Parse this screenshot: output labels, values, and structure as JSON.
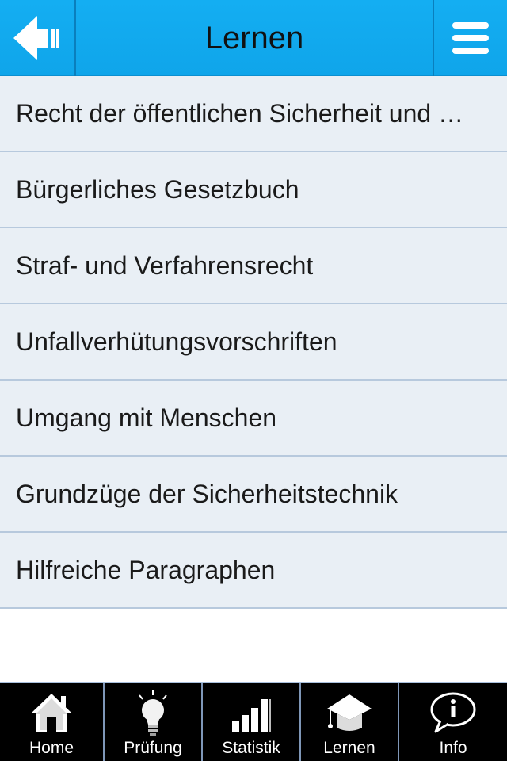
{
  "header": {
    "title": "Lernen",
    "back_icon": "back-arrow-icon",
    "menu_icon": "hamburger-menu-icon",
    "color": "#12abf0"
  },
  "list": {
    "items": [
      {
        "label": "Recht der öffentlichen Sicherheit und …"
      },
      {
        "label": "Bürgerliches Gesetzbuch"
      },
      {
        "label": "Straf- und Verfahrensrecht"
      },
      {
        "label": "Unfallverhütungsvorschriften"
      },
      {
        "label": "Umgang mit Menschen"
      },
      {
        "label": "Grundzüge der Sicherheitstechnik"
      },
      {
        "label": "Hilfreiche Paragraphen"
      }
    ]
  },
  "tabbar": {
    "tabs": [
      {
        "label": "Home",
        "icon": "house-icon"
      },
      {
        "label": "Prüfung",
        "icon": "lightbulb-icon"
      },
      {
        "label": "Statistik",
        "icon": "bar-chart-icon"
      },
      {
        "label": "Lernen",
        "icon": "graduation-cap-icon"
      },
      {
        "label": "Info",
        "icon": "info-speech-bubble-icon"
      }
    ]
  }
}
